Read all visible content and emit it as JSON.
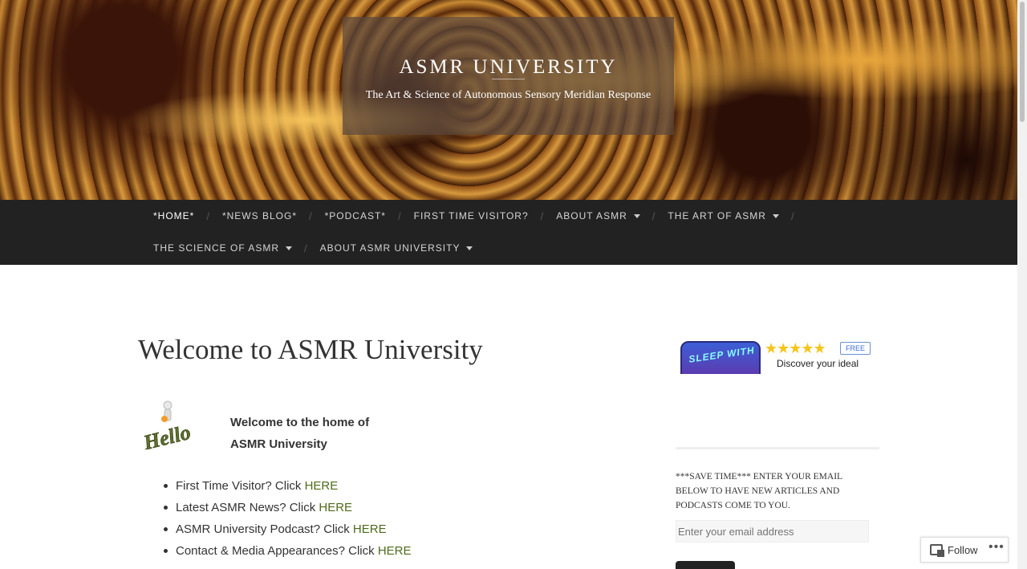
{
  "header": {
    "site_title": "ASMR UNIVERSITY",
    "site_description": "The Art & Science of Autonomous Sensory Meridian Response"
  },
  "nav": {
    "row1": [
      {
        "label": "*HOME*",
        "has_dropdown": false,
        "active": true
      },
      {
        "label": "*NEWS BLOG*",
        "has_dropdown": false
      },
      {
        "label": "*PODCAST*",
        "has_dropdown": false
      },
      {
        "label": "FIRST TIME VISITOR?",
        "has_dropdown": false
      },
      {
        "label": "ABOUT ASMR",
        "has_dropdown": true
      },
      {
        "label": "THE ART OF ASMR",
        "has_dropdown": true
      }
    ],
    "row2": [
      {
        "label": "THE SCIENCE OF ASMR",
        "has_dropdown": true
      },
      {
        "label": "ABOUT ASMR UNIVERSITY",
        "has_dropdown": true
      }
    ],
    "separator": "/"
  },
  "main": {
    "page_title": "Welcome to ASMR University",
    "hello_image_text": "Hello",
    "welcome_line1": "Welcome to the home of",
    "welcome_line2": "ASMR University",
    "links": [
      {
        "text": "First Time Visitor?  Click ",
        "link": "HERE"
      },
      {
        "text": "Latest ASMR News?  Click ",
        "link": "HERE"
      },
      {
        "text": "ASMR University Podcast? Click ",
        "link": "HERE"
      },
      {
        "text": "Contact & Media Appearances? Click ",
        "link": "HERE"
      }
    ]
  },
  "sidebar": {
    "ad": {
      "icon_text": "SLEEP WITH",
      "stars": "★★★★★",
      "badge": "FREE",
      "description": "Discover your ideal"
    },
    "subscribe_text": "***SAVE TIME*** ENTER YOUR EMAIL BELOW TO HAVE NEW ARTICLES AND PODCASTS COME TO YOU.",
    "email_placeholder": "Enter your email address"
  },
  "follow_bar": {
    "label": "Follow",
    "more": "•••"
  },
  "colors": {
    "nav_bg": "#222222",
    "link": "#4e6b1a",
    "title_card": "#5a463c"
  }
}
